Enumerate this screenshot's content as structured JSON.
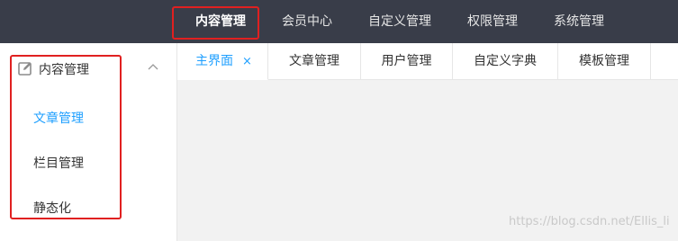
{
  "topnav": {
    "items": [
      {
        "label": "内容管理",
        "active": true
      },
      {
        "label": "会员中心",
        "active": false
      },
      {
        "label": "自定义管理",
        "active": false
      },
      {
        "label": "权限管理",
        "active": false
      },
      {
        "label": "系统管理",
        "active": false
      }
    ]
  },
  "sidebar": {
    "group_icon": "edit-icon",
    "group_label": "内容管理",
    "group_expanded_icon": "chevron-up-icon",
    "items": [
      {
        "label": "文章管理",
        "active": true
      },
      {
        "label": "栏目管理",
        "active": false
      },
      {
        "label": "静态化",
        "active": false
      }
    ]
  },
  "tabs": {
    "items": [
      {
        "label": "主界面",
        "active": true,
        "closable": true
      },
      {
        "label": "文章管理",
        "active": false
      },
      {
        "label": "用户管理",
        "active": false
      },
      {
        "label": "自定义字典",
        "active": false
      },
      {
        "label": "模板管理",
        "active": false
      }
    ],
    "close_symbol": "×"
  },
  "watermark": "https://blog.csdn.net/Ellis_li",
  "colors": {
    "header_bg": "#393d49",
    "accent": "#1e9fff",
    "content_bg": "#f2f2f2",
    "annotation": "#e02020"
  }
}
